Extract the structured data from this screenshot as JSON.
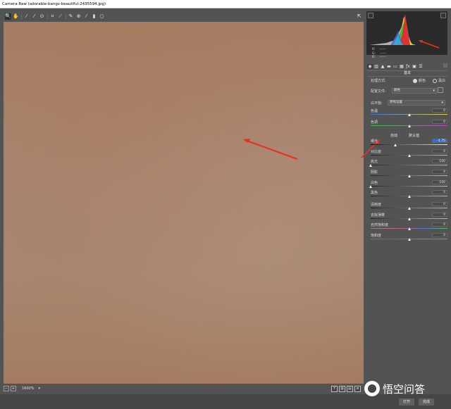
{
  "window": {
    "title": "Camera Raw (adorable-bangs-beautiful-2435594.jpg)"
  },
  "toolbar": {
    "tools": [
      {
        "name": "zoom-tool-icon",
        "glyph": "🔍",
        "active": true
      },
      {
        "name": "hand-tool-icon",
        "glyph": "✋",
        "active": false
      },
      {
        "name": "white-balance-tool-icon",
        "glyph": "⁄",
        "active": false
      },
      {
        "name": "color-sampler-tool-icon",
        "glyph": "⁄",
        "active": false
      },
      {
        "name": "targeted-adjustment-tool-icon",
        "glyph": "⊙",
        "active": false
      },
      {
        "name": "crop-tool-icon",
        "glyph": "⌗",
        "active": false
      },
      {
        "name": "straighten-tool-icon",
        "glyph": "⟋",
        "active": false
      },
      {
        "name": "spot-removal-tool-icon",
        "glyph": "✎",
        "active": false
      },
      {
        "name": "red-eye-tool-icon",
        "glyph": "⊕",
        "active": false
      },
      {
        "name": "adjustment-brush-tool-icon",
        "glyph": "⁄",
        "active": false
      },
      {
        "name": "graduated-filter-tool-icon",
        "glyph": "▮",
        "active": false
      },
      {
        "name": "radial-filter-tool-icon",
        "glyph": "○",
        "active": false
      }
    ],
    "fullscreen_glyph": "⇱"
  },
  "status": {
    "zoom": "1600%",
    "zoom_caret": "▾",
    "zoom_out": "−",
    "zoom_in": "+"
  },
  "view_buttons": [
    "Y",
    "▥",
    "▤",
    "≡"
  ],
  "histogram": {
    "r": "R:",
    "g": "G:",
    "b": "B:",
    "dash": "——"
  },
  "panel_tabs": [
    "◉",
    "▥",
    "▲",
    "▬",
    "▭",
    "▦",
    "ƒx",
    "▣",
    "☰"
  ],
  "basic": {
    "title": "基本",
    "treatment_label": "处理方式:",
    "treatment_color": "颜色",
    "treatment_bw": "黑白",
    "profile_label": "配置文件:",
    "profile_value": "颜色",
    "wb_label": "白平衡:",
    "wb_value": "原照设置",
    "auto_label": "自动",
    "default_label": "默认值",
    "sliders": [
      {
        "key": "temp",
        "label": "色温",
        "value": "0",
        "pos": 0.5,
        "track": "temp",
        "highlight": false
      },
      {
        "key": "tint",
        "label": "色调",
        "value": "0",
        "pos": 0.5,
        "track": "tint",
        "highlight": false
      },
      {
        "key": "exposure",
        "label": "曝光",
        "value": "-1.75",
        "pos": 0.32,
        "track": "exposure",
        "highlight": true
      },
      {
        "key": "contrast",
        "label": "对比度",
        "value": "0",
        "pos": 0.5,
        "track": "gray",
        "highlight": false
      },
      {
        "key": "highlights",
        "label": "高光",
        "value": "-100",
        "pos": 0.0,
        "track": "gray",
        "highlight": false
      },
      {
        "key": "shadows",
        "label": "阴影",
        "value": "0",
        "pos": 0.5,
        "track": "gray",
        "highlight": false
      },
      {
        "key": "whites",
        "label": "白色",
        "value": "-100",
        "pos": 0.0,
        "track": "gray",
        "highlight": false
      },
      {
        "key": "blacks",
        "label": "黑色",
        "value": "0",
        "pos": 0.5,
        "track": "gray",
        "highlight": false
      },
      {
        "key": "clarity",
        "label": "清晰度",
        "value": "0",
        "pos": 0.5,
        "track": "gray",
        "highlight": false
      },
      {
        "key": "dehaze",
        "label": "去除薄雾",
        "value": "0",
        "pos": 0.5,
        "track": "gray",
        "highlight": false
      },
      {
        "key": "vibrance",
        "label": "自然饱和度",
        "value": "0",
        "pos": 0.5,
        "track": "vib",
        "highlight": false
      },
      {
        "key": "saturation",
        "label": "饱和度",
        "value": "0",
        "pos": 0.5,
        "track": "sat",
        "highlight": false
      }
    ]
  },
  "footer": {
    "open_label": "打开",
    "done_label": "完成"
  },
  "brand": {
    "text": "悟空问答"
  }
}
